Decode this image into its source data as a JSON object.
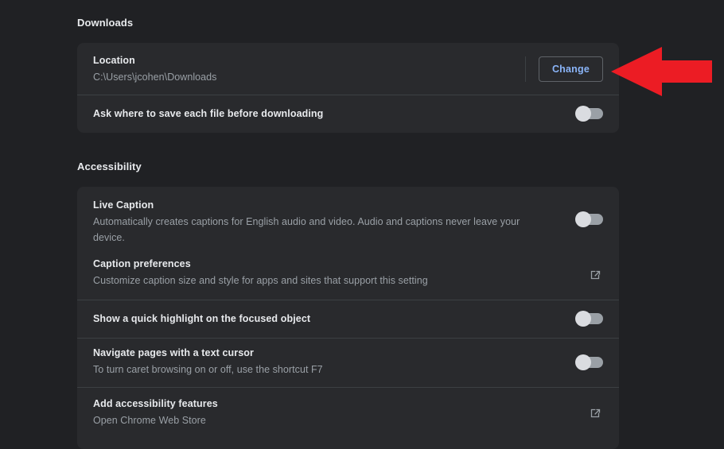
{
  "sections": [
    {
      "id": "downloads",
      "title": "Downloads",
      "rows": [
        {
          "primary": "Location",
          "secondary": "C:\\Users\\jcohen\\Downloads",
          "action": "button",
          "action_label": "Change"
        },
        {
          "primary": "Ask where to save each file before downloading",
          "secondary": "",
          "action": "toggle",
          "toggle_state": "off"
        }
      ]
    },
    {
      "id": "accessibility",
      "title": "Accessibility",
      "rows": [
        {
          "primary": "Live Caption",
          "secondary": "Automatically creates captions for English audio and video. Audio and captions never leave your device.",
          "action": "toggle",
          "toggle_state": "off"
        },
        {
          "primary": "Caption preferences",
          "secondary": "Customize caption size and style for apps and sites that support this setting",
          "action": "external-link",
          "action_icon": "open-in-new-icon"
        },
        {
          "primary": "Show a quick highlight on the focused object",
          "secondary": "",
          "action": "toggle",
          "toggle_state": "off"
        },
        {
          "primary": "Navigate pages with a text cursor",
          "secondary": "To turn caret browsing on or off, use the shortcut F7",
          "action": "toggle",
          "toggle_state": "off"
        },
        {
          "primary": "Add accessibility features",
          "secondary": "Open Chrome Web Store",
          "action": "external-link",
          "action_icon": "open-in-new-icon"
        }
      ]
    }
  ],
  "annotation": {
    "type": "arrow",
    "direction": "left",
    "color": "#EC1C24",
    "points_at": "Change"
  },
  "colors": {
    "page_background": "#202124",
    "card_background": "#292a2d",
    "primary_text": "#e8eaed",
    "secondary_text": "#9aa0a6",
    "link_accent": "#8ab4f8",
    "divider": "#3c4043",
    "toggle_track_off": "#9aa0a6",
    "toggle_knob": "#dadce0",
    "annotation_red": "#EC1C24"
  }
}
